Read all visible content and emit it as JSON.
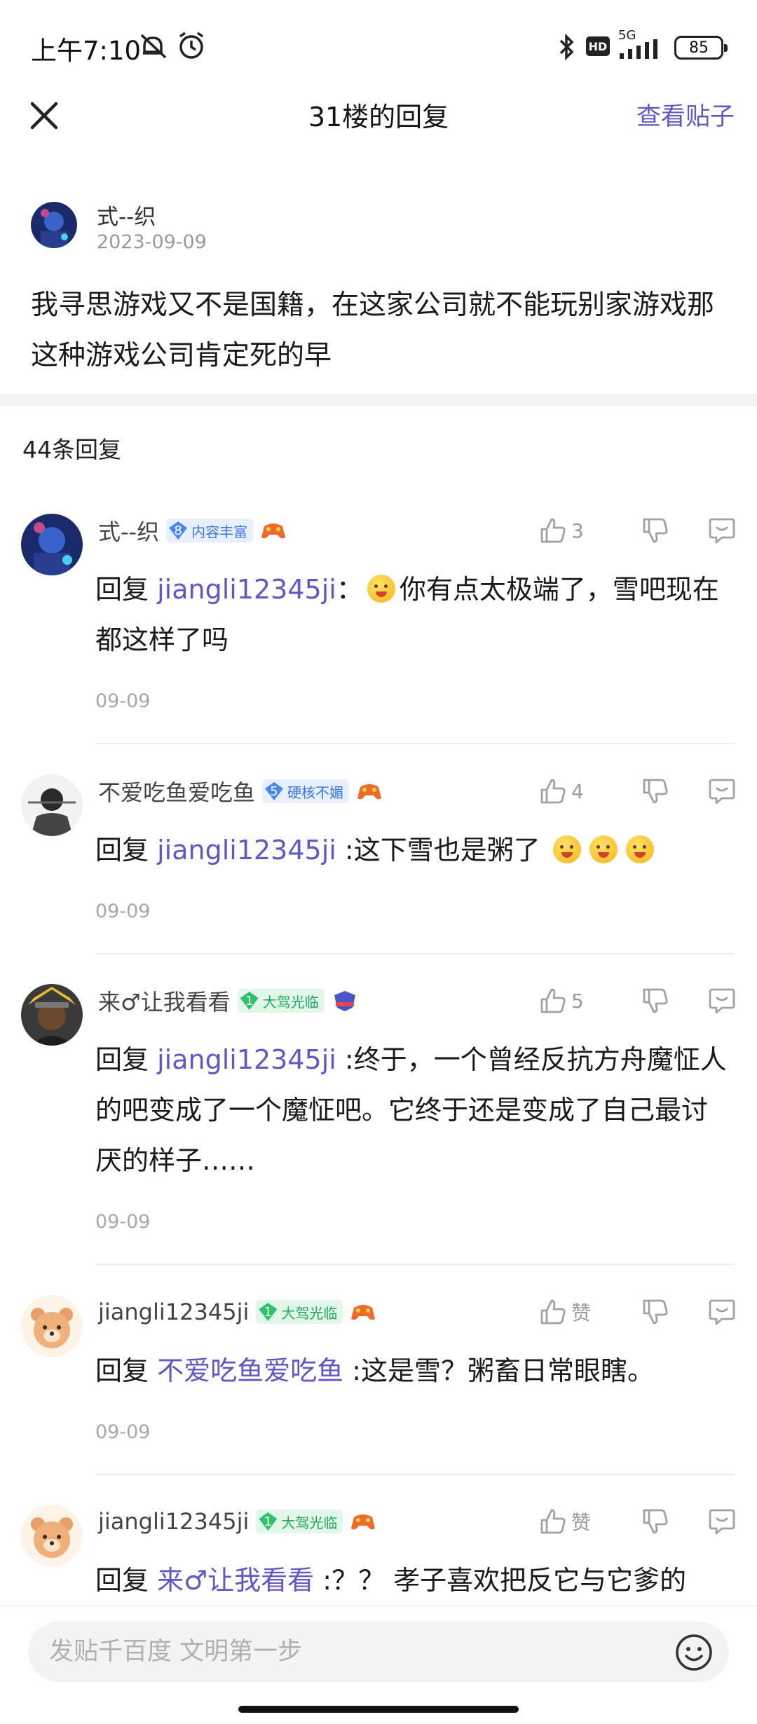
{
  "status_bar": {
    "time": "上午7:10",
    "network": "5G",
    "hd": "HD",
    "battery": "85"
  },
  "header": {
    "title": "31楼的回复",
    "view_post": "查看贴子"
  },
  "op": {
    "username": "式--织",
    "date": "2023-09-09",
    "text": "我寻思游戏又不是国籍，在这家公司就不能玩别家游戏那这种游戏公司肯定死的早"
  },
  "reply_count": "44条回复",
  "replies": [
    {
      "username": "式--织",
      "badge_level": "8",
      "badge_text": "内容丰富",
      "like": "3",
      "reply_prefix": "回复",
      "mention": "jiangli12345ji",
      "colon": "：",
      "text": "你有点太极端了，雪吧现在都这样了吗",
      "time": "09-09"
    },
    {
      "username": "不爱吃鱼爱吃鱼",
      "badge_level": "5",
      "badge_text": "硬核不媚",
      "like": "4",
      "reply_prefix": "回复",
      "mention": "jiangli12345ji",
      "colon": " :",
      "text": "这下雪也是粥了",
      "time": "09-09"
    },
    {
      "username": "来♂让我看看",
      "badge_level": "1",
      "badge_text": "大驾光临",
      "like": "5",
      "reply_prefix": "回复",
      "mention": "jiangli12345ji",
      "colon": " :",
      "text": "终于，一个曾经反抗方舟魔怔人的吧变成了一个魔怔吧。它终于还是变成了自己最讨厌的样子……",
      "time": "09-09"
    },
    {
      "username": "jiangli12345ji",
      "badge_level": "1",
      "badge_text": "大驾光临",
      "like": "赞",
      "reply_prefix": "回复",
      "mention": "不爱吃鱼爱吃鱼",
      "colon": " :",
      "text": "这是雪？粥畜日常眼瞎。",
      "time": "09-09"
    },
    {
      "username": "jiangli12345ji",
      "badge_level": "1",
      "badge_text": "大驾光临",
      "like": "赞",
      "reply_prefix": "回复",
      "mention": "来♂让我看看",
      "colon": " :",
      "text": "？？ 孝子喜欢把反它与它爹的",
      "time": ""
    }
  ],
  "input": {
    "placeholder": "发贴千百度 文明第一步"
  },
  "colors": {
    "accent": "#5f58c7",
    "badge_blue": "#4a86f0",
    "badge_green": "#2cc26a"
  },
  "icons": [
    "close-icon",
    "thumb-up-icon",
    "thumb-down-icon",
    "comment-icon",
    "emoji-icon",
    "bluetooth-icon",
    "signal-icon",
    "alarm-icon",
    "mute-icon"
  ]
}
